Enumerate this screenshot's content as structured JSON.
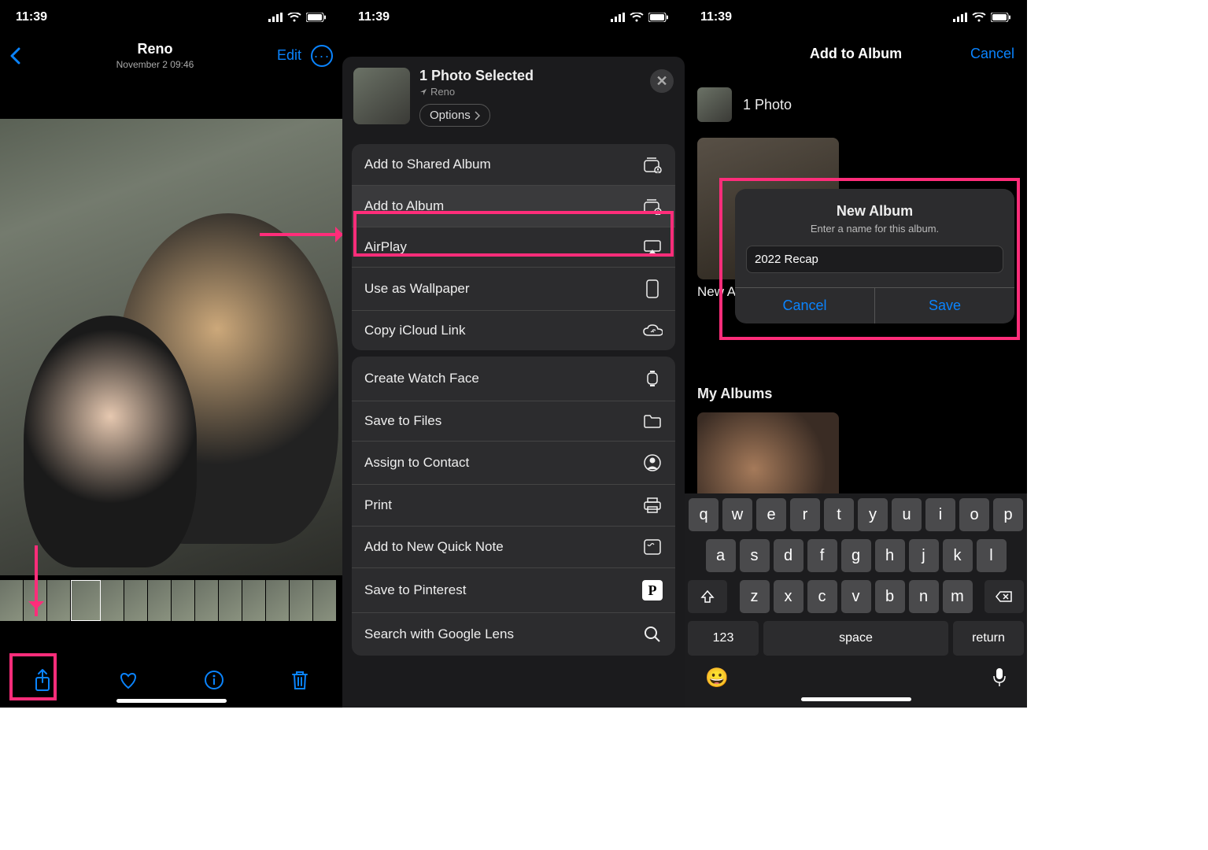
{
  "status": {
    "time": "11:39"
  },
  "panel1": {
    "header": {
      "title": "Reno",
      "subtitle": "November 2  09:46",
      "edit": "Edit"
    }
  },
  "panel2": {
    "title": "1 Photo Selected",
    "location": "Reno",
    "options": "Options",
    "rows": {
      "addShared": "Add to Shared Album",
      "addAlbum": "Add to Album",
      "airplay": "AirPlay",
      "wallpaper": "Use as Wallpaper",
      "icloud": "Copy iCloud Link",
      "watchface": "Create Watch Face",
      "files": "Save to Files",
      "contact": "Assign to Contact",
      "print": "Print",
      "quicknote": "Add to New Quick Note",
      "pinterest": "Save to Pinterest",
      "glens": "Search with Google Lens"
    }
  },
  "panel3": {
    "navTitle": "Add to Album",
    "navCancel": "Cancel",
    "photoCount": "1 Photo",
    "newAlbumLabel": "New Album…",
    "alert": {
      "title": "New Album",
      "subtitle": "Enter a name for this album.",
      "value": "2022 Recap",
      "cancel": "Cancel",
      "save": "Save"
    },
    "myAlbums": "My Albums",
    "keyboard": {
      "row1": [
        "q",
        "w",
        "e",
        "r",
        "t",
        "y",
        "u",
        "i",
        "o",
        "p"
      ],
      "row2": [
        "a",
        "s",
        "d",
        "f",
        "g",
        "h",
        "j",
        "k",
        "l"
      ],
      "row3": [
        "z",
        "x",
        "c",
        "v",
        "b",
        "n",
        "m"
      ],
      "k123": "123",
      "space": "space",
      "return": "return"
    }
  }
}
